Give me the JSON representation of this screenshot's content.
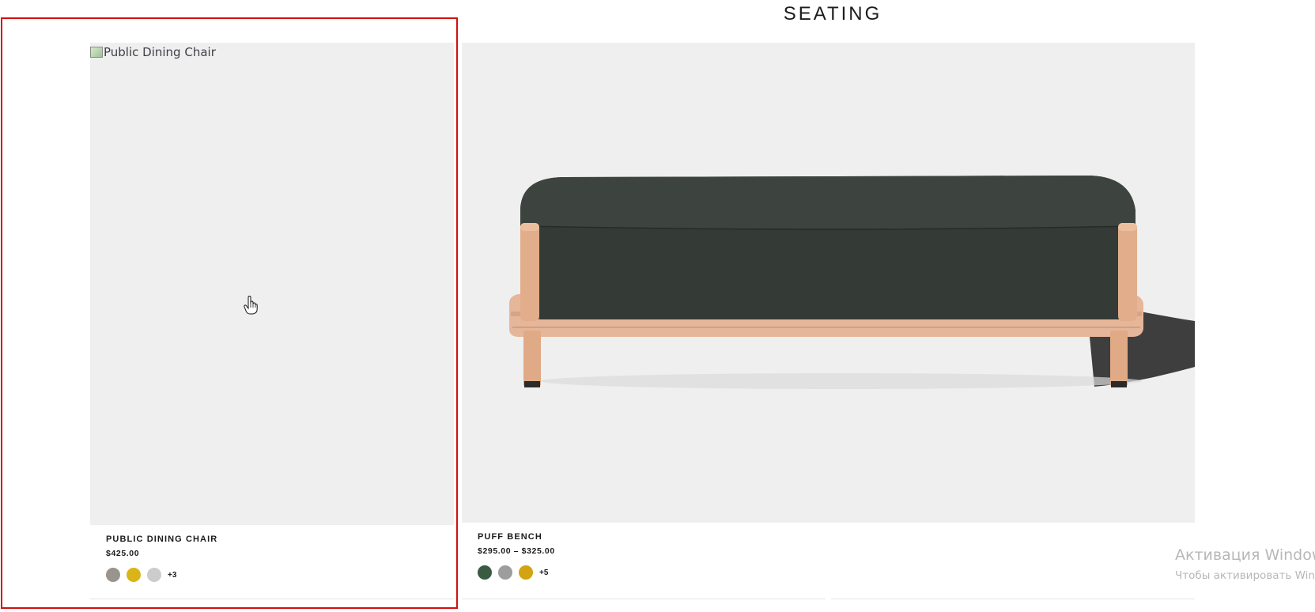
{
  "section": {
    "title": "SEATING"
  },
  "products": [
    {
      "name": "PUBLIC DINING CHAIR",
      "price": "$425.00",
      "image_alt": "Public Dining Chair",
      "swatches": [
        "#9a948f",
        "#d9b51a",
        "#cccccc"
      ],
      "more_colors": "+3"
    },
    {
      "name": "PUFF BENCH",
      "price": "$295.00 – $325.00",
      "image_alt": "Puff Bench",
      "swatches": [
        "#3a5a42",
        "#9d9d9d",
        "#d2a312"
      ],
      "more_colors": "+5"
    }
  ],
  "windows_notice": {
    "title": "Активация Windows",
    "subtitle": "Чтобы активировать Windows"
  },
  "colors": {
    "highlight": "#d20f0f",
    "image_bg": "#efefef"
  }
}
